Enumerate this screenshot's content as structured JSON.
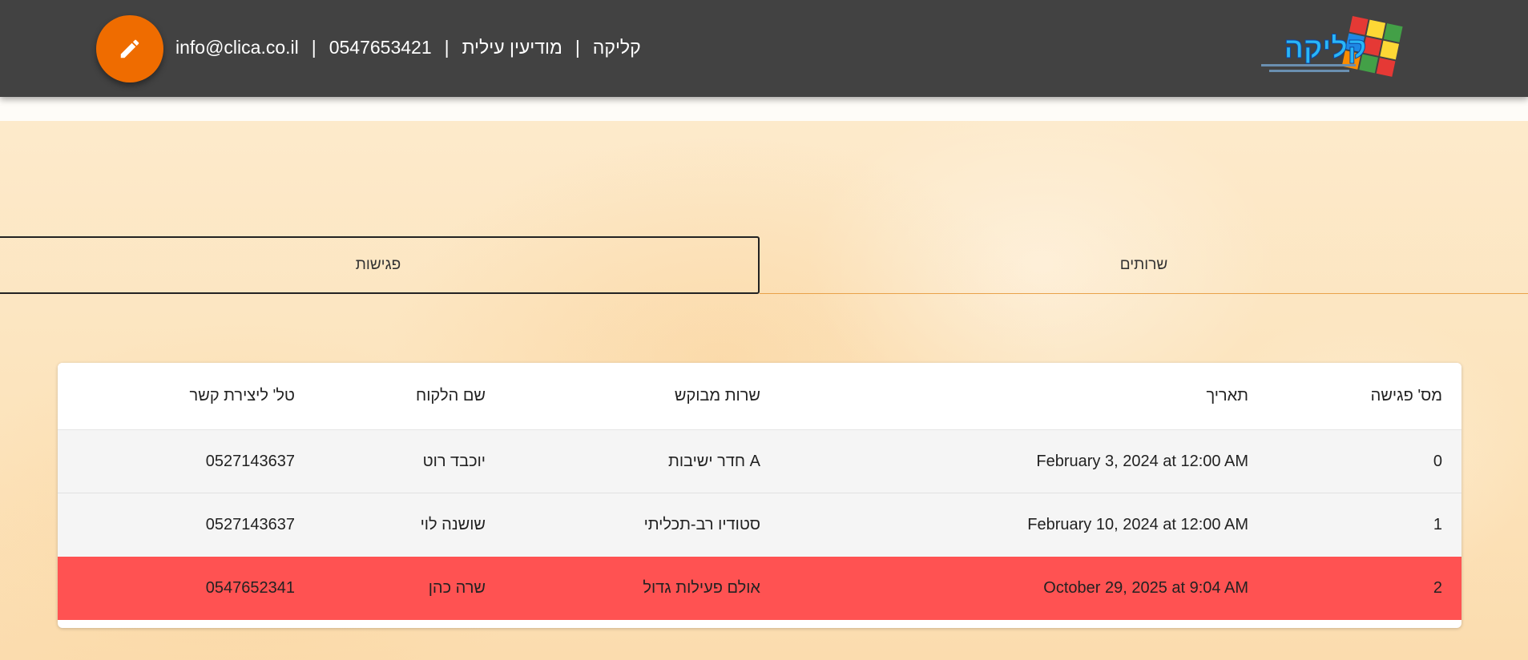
{
  "header": {
    "contact_parts": [
      "info@clica.co.il",
      "0547653421",
      "מודיעין עילית",
      "קליקה"
    ],
    "separator": "|",
    "background": "#424242",
    "fab_color": "#ef6c00",
    "fab_icon": "pencil-icon",
    "logo_text": "קליקה"
  },
  "tabs": [
    {
      "label": "פגישות",
      "selected": true
    },
    {
      "label": "שרותים",
      "selected": false
    }
  ],
  "table": {
    "columns": [
      "מס' פגישה",
      "תאריך",
      "שרות מבוקש",
      "שם הלקוח",
      "טל' ליצירת קשר"
    ],
    "rows": [
      {
        "num": "0",
        "date": "February 3, 2024 at 12:00 AM",
        "service": "חדר ישיבות A",
        "client": "יוכבד רוט",
        "phone": "0527143637"
      },
      {
        "num": "1",
        "date": "February 10, 2024 at 12:00 AM",
        "service": "סטודיו רב-תכליתי",
        "client": "שושנה לוי",
        "phone": "0527143637"
      },
      {
        "num": "2",
        "date": "October 29, 2025 at 9:04 AM",
        "service": "אולם פעילות גדול",
        "client": "שרה כהן",
        "phone": "0547652341",
        "highlight": "#ff5252"
      }
    ]
  }
}
